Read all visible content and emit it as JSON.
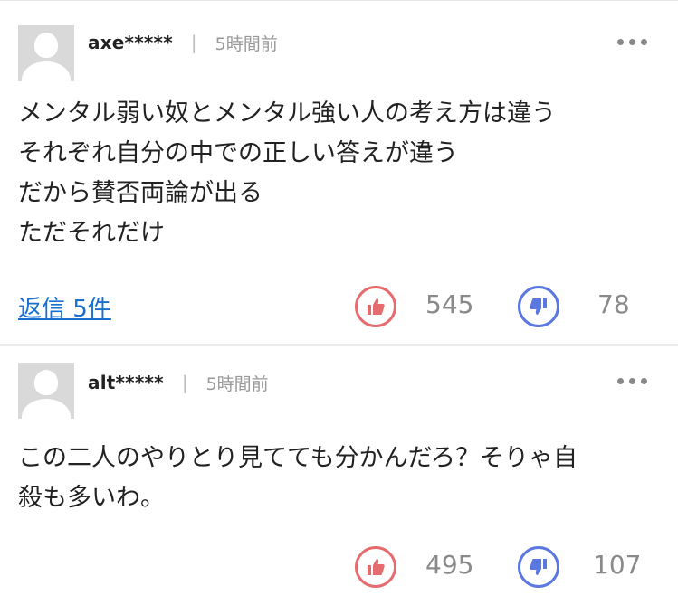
{
  "comments": [
    {
      "username": "axe*****",
      "time": "5時間前",
      "body": "メンタル弱い奴とメンタル強い人の考え方は違う\nそれぞれ自分の中での正しい答えが違う\nだから賛否両論が出る\nただそれだけ",
      "replies_label": "返信 5件",
      "likes": "545",
      "dislikes": "78"
    },
    {
      "username": "alt*****",
      "time": "5時間前",
      "body": "この二人のやりとり見てても分かんだろ？そりゃ自\n殺も多いわ。",
      "likes": "495",
      "dislikes": "107"
    }
  ],
  "colors": {
    "like": "#e66b6f",
    "dislike": "#5b77e0",
    "link": "#1a6fce"
  },
  "icons": [
    "avatar-placeholder-icon",
    "more-options-icon",
    "thumbs-up-icon",
    "thumbs-down-icon"
  ]
}
